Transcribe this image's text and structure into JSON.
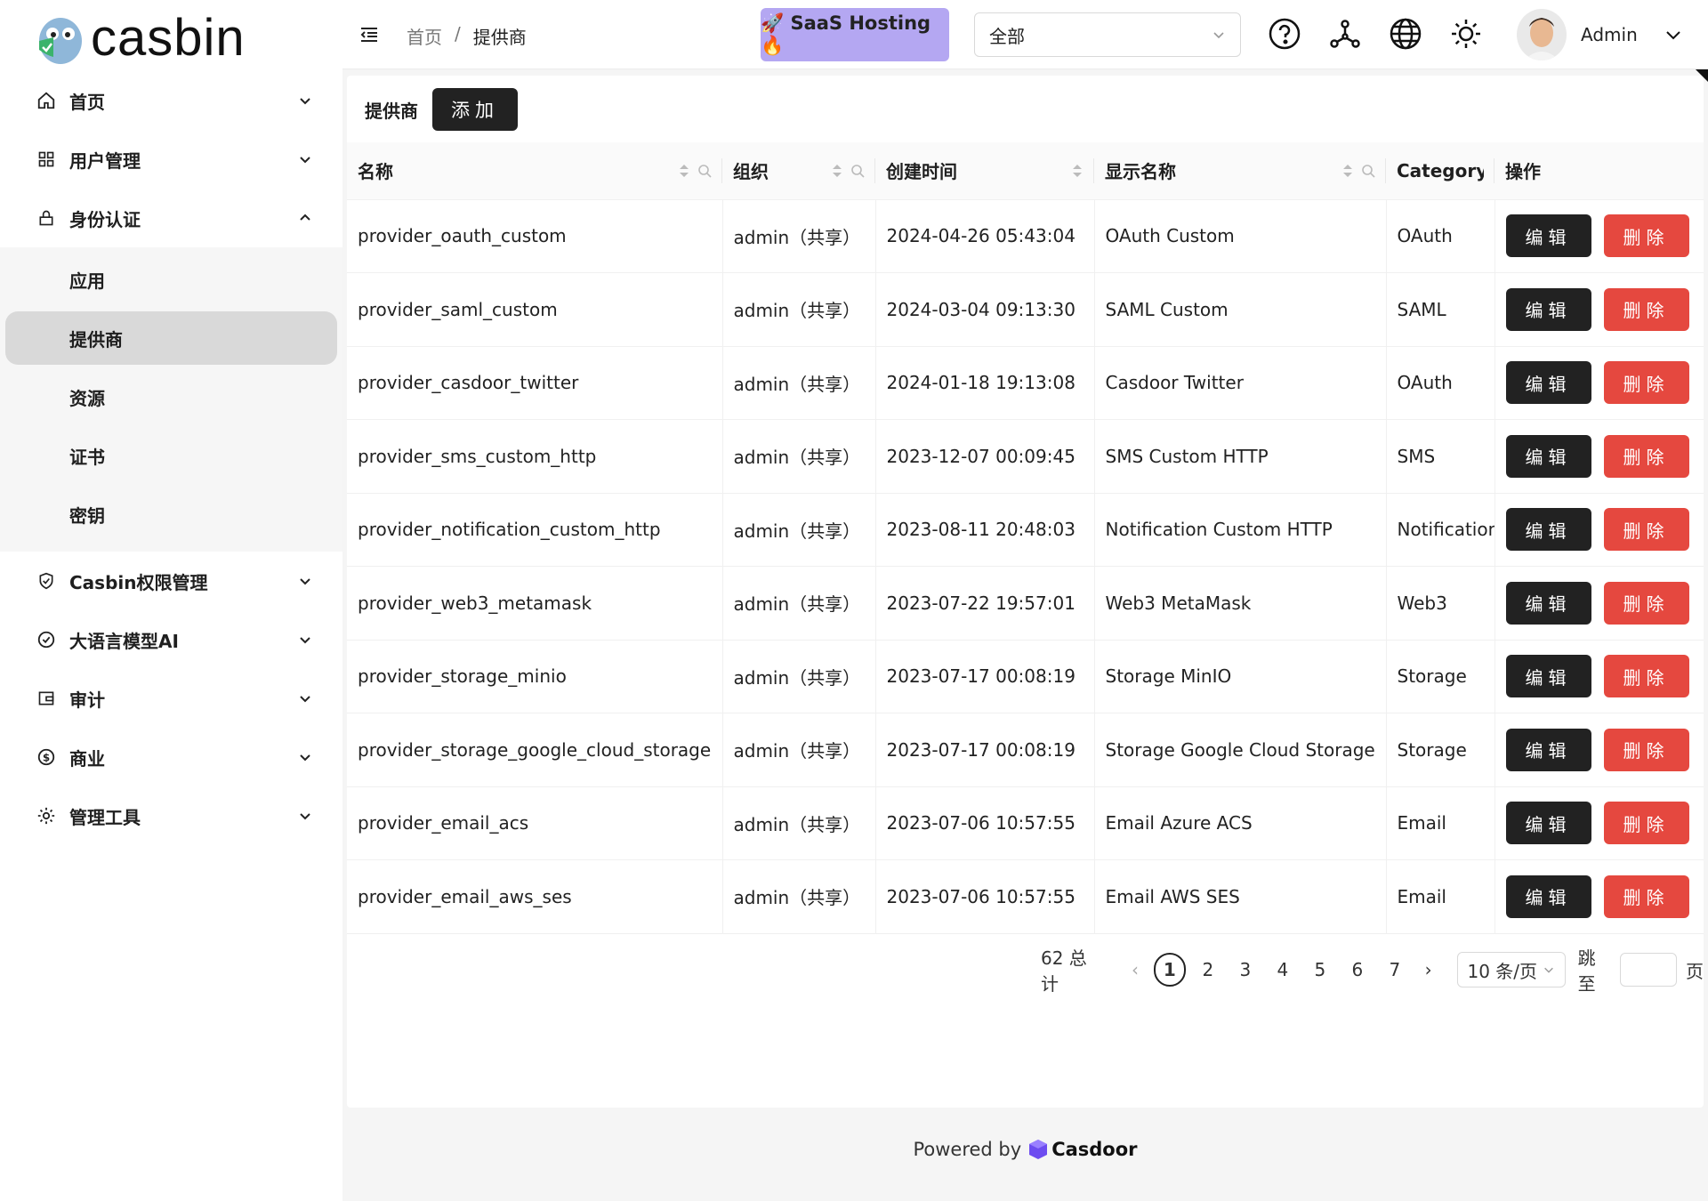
{
  "brand": {
    "name": "casbin"
  },
  "sidebar": {
    "items": [
      {
        "label": "首页",
        "icon": "home-icon",
        "expanded": false
      },
      {
        "label": "用户管理",
        "icon": "grid-icon",
        "expanded": false
      },
      {
        "label": "身份认证",
        "icon": "lock-icon",
        "expanded": true,
        "children": [
          "应用",
          "提供商",
          "资源",
          "证书",
          "密钥"
        ],
        "active_child": "提供商"
      },
      {
        "label": "Casbin权限管理",
        "icon": "shield-check-icon",
        "expanded": false
      },
      {
        "label": "大语言模型AI",
        "icon": "check-circle-icon",
        "expanded": false
      },
      {
        "label": "审计",
        "icon": "wallet-icon",
        "expanded": false
      },
      {
        "label": "商业",
        "icon": "dollar-icon",
        "expanded": false
      },
      {
        "label": "管理工具",
        "icon": "gear-icon",
        "expanded": false
      }
    ]
  },
  "header": {
    "breadcrumb": {
      "home": "首页",
      "separator": "/",
      "current": "提供商"
    },
    "saas_button": "🚀 SaaS Hosting 🔥",
    "org_select": {
      "value": "全部"
    },
    "user_name": "Admin"
  },
  "main": {
    "title": "提供商",
    "add_button": "添加",
    "columns": [
      "名称",
      "组织",
      "创建时间",
      "显示名称",
      "Category",
      "操作"
    ],
    "edit_label": "编辑",
    "delete_label": "删除",
    "rows": [
      {
        "name": "provider_oauth_custom",
        "org": "admin（共享）",
        "created": "2024-04-26 05:43:04",
        "display": "OAuth Custom",
        "category": "OAuth"
      },
      {
        "name": "provider_saml_custom",
        "org": "admin（共享）",
        "created": "2024-03-04 09:13:30",
        "display": "SAML Custom",
        "category": "SAML"
      },
      {
        "name": "provider_casdoor_twitter",
        "org": "admin（共享）",
        "created": "2024-01-18 19:13:08",
        "display": "Casdoor Twitter",
        "category": "OAuth"
      },
      {
        "name": "provider_sms_custom_http",
        "org": "admin（共享）",
        "created": "2023-12-07 00:09:45",
        "display": "SMS Custom HTTP",
        "category": "SMS"
      },
      {
        "name": "provider_notification_custom_http",
        "org": "admin（共享）",
        "created": "2023-08-11 20:48:03",
        "display": "Notification Custom HTTP",
        "category": "Notification"
      },
      {
        "name": "provider_web3_metamask",
        "org": "admin（共享）",
        "created": "2023-07-22 19:57:01",
        "display": "Web3 MetaMask",
        "category": "Web3"
      },
      {
        "name": "provider_storage_minio",
        "org": "admin（共享）",
        "created": "2023-07-17 00:08:19",
        "display": "Storage MinIO",
        "category": "Storage"
      },
      {
        "name": "provider_storage_google_cloud_storage",
        "org": "admin（共享）",
        "created": "2023-07-17 00:08:19",
        "display": "Storage Google Cloud Storage",
        "category": "Storage"
      },
      {
        "name": "provider_email_acs",
        "org": "admin（共享）",
        "created": "2023-07-06 10:57:55",
        "display": "Email Azure ACS",
        "category": "Email"
      },
      {
        "name": "provider_email_aws_ses",
        "org": "admin（共享）",
        "created": "2023-07-06 10:57:55",
        "display": "Email AWS SES",
        "category": "Email"
      }
    ],
    "pagination": {
      "total": "62 总计",
      "pages": [
        "1",
        "2",
        "3",
        "4",
        "5",
        "6",
        "7"
      ],
      "current": "1",
      "page_size": "10 条/页",
      "jump_label": "跳至",
      "jump_suffix": "页"
    }
  },
  "footer": {
    "powered_by": "Powered by",
    "brand": "Casdoor"
  },
  "colors": {
    "accent_dark": "#222222",
    "danger": "#e5483f",
    "saas": "#b4a7f2",
    "active_bg": "#d9d9d9"
  }
}
